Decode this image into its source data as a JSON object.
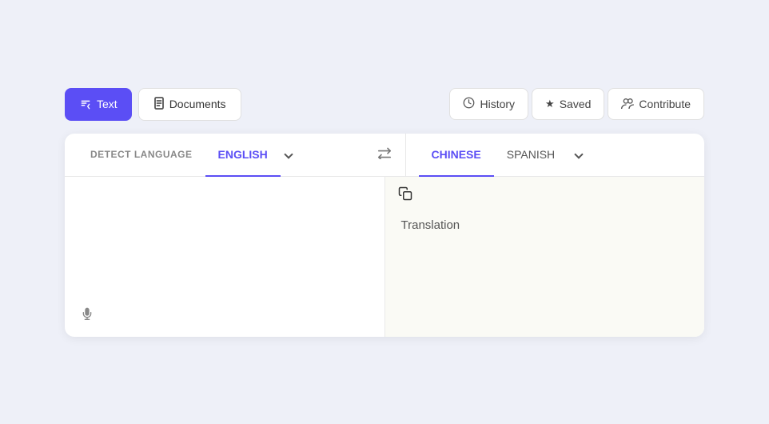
{
  "app": {
    "background_color": "#eef0f8"
  },
  "nav": {
    "left": {
      "text_btn_label": "Text",
      "documents_btn_label": "Documents"
    },
    "right": {
      "history_label": "History",
      "saved_label": "Saved",
      "contribute_label": "Contribute"
    }
  },
  "language_bar": {
    "left": {
      "detect_label": "DETECT LANGUAGE",
      "active_lang": "ENGLISH",
      "dropdown_aria": "Language dropdown left"
    },
    "swap_aria": "Swap languages",
    "right": {
      "active_lang": "CHINESE",
      "inactive_lang": "SPANISH",
      "dropdown_aria": "Language dropdown right"
    }
  },
  "input_panel": {
    "placeholder": "",
    "mic_aria": "Microphone"
  },
  "output_panel": {
    "copy_aria": "Copy translation",
    "translation_text": "Translation"
  }
}
